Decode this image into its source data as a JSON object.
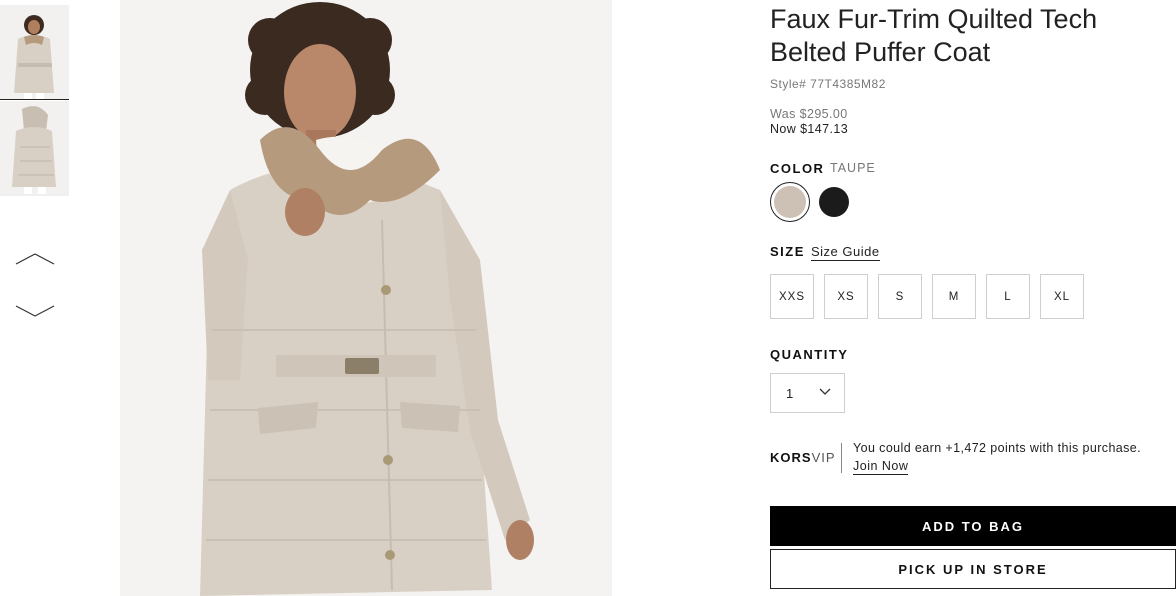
{
  "gallery": {
    "thumbnails": [
      {
        "name": "front view",
        "selected": true
      },
      {
        "name": "side view",
        "selected": false
      }
    ],
    "prev_icon": "chevron-up-icon",
    "next_icon": "chevron-down-icon"
  },
  "product": {
    "title": "Faux Fur-Trim Quilted Tech Belted Puffer Coat",
    "style_number": "Style# 77T4385M82",
    "price_was": "Was $295.00",
    "price_now": "Now $147.13"
  },
  "color": {
    "label": "COLOR",
    "selected_name": "TAUPE",
    "swatches": [
      {
        "name": "Taupe",
        "hex": "#cdc0b4",
        "selected": true
      },
      {
        "name": "Black",
        "hex": "#1b1b1b",
        "selected": false
      }
    ]
  },
  "size": {
    "label": "SIZE",
    "guide_link": "Size Guide",
    "options": [
      "XXS",
      "XS",
      "S",
      "M",
      "L",
      "XL"
    ]
  },
  "quantity": {
    "label": "QUANTITY",
    "value": "1",
    "icon": "chevron-down-icon"
  },
  "loyalty": {
    "brand_bold": "KORS",
    "brand_light": "VIP",
    "message": "You could earn +1,472 points with this purchase.",
    "join_link": "Join Now"
  },
  "actions": {
    "add_to_bag": "ADD TO BAG",
    "pick_up": "PICK UP IN STORE"
  },
  "colors": {
    "coat": "#d9d0c5",
    "fur": "#b59a7e",
    "accent": "#000000"
  }
}
